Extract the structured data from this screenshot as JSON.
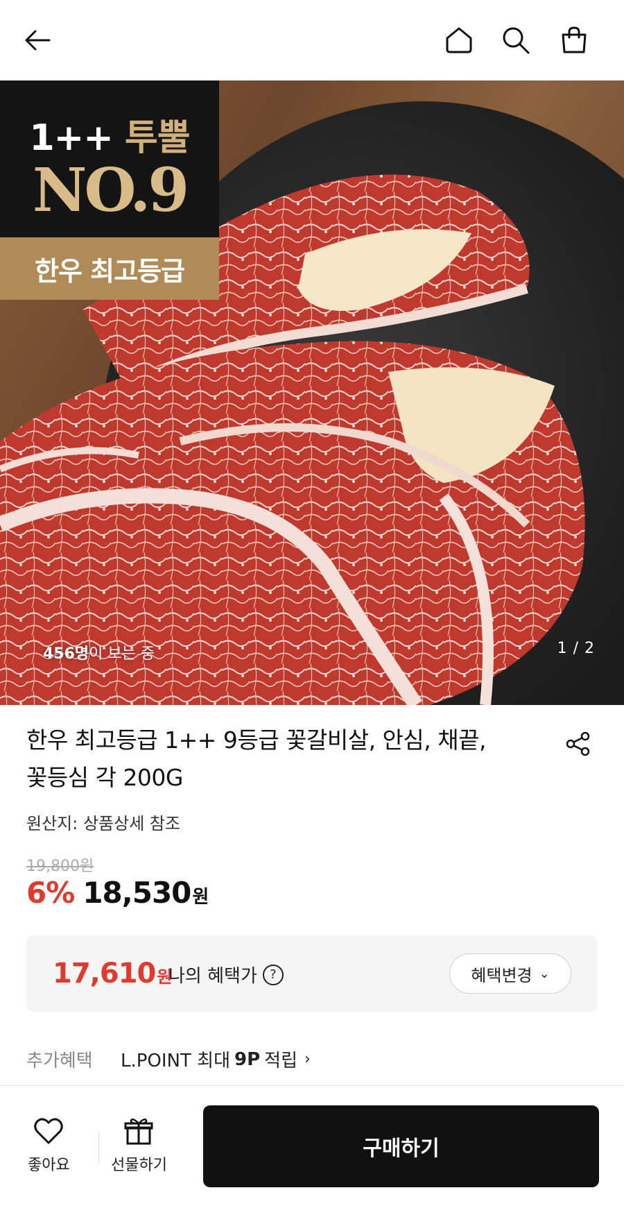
{
  "header": {
    "back_icon": "arrow-left-icon",
    "home_icon": "home-icon",
    "search_icon": "search-icon",
    "cart_icon": "shopping-bag-icon"
  },
  "hero": {
    "badge": {
      "line1_a": "1++",
      "line1_b": "투뿔",
      "line2": "NO.9",
      "bottom": "한우 최고등급"
    },
    "viewers_count": "456명",
    "viewers_text": "이 보는 중",
    "pager": "1 / 2"
  },
  "product": {
    "title_line1": "한우 최고등급 1++ 9등급 꽃갈비살, 안심, 채끝,",
    "title_line2": "꽃등심 각 200G",
    "share_icon": "share-icon",
    "origin": "원산지: 상품상세 참조",
    "original_price": "19,800원",
    "discount": "6%",
    "price": "18,530",
    "currency": "원"
  },
  "benefit": {
    "price": "17,610",
    "currency": "원",
    "label": "나의 혜택가",
    "help": "?",
    "change_button": "혜택변경",
    "change_chevron": "⌄"
  },
  "extra": {
    "label": "추가혜택",
    "value_prefix": "L.POINT 최대",
    "value_bold": "9P",
    "value_suffix": "적립",
    "arrow": "›"
  },
  "bottom_bar": {
    "like_label": "좋아요",
    "gift_label": "선물하기",
    "buy_label": "구매하기"
  },
  "colors": {
    "accent_red": "#e03a2e",
    "badge_gold": "#b08a57",
    "buy_button": "#111111"
  }
}
